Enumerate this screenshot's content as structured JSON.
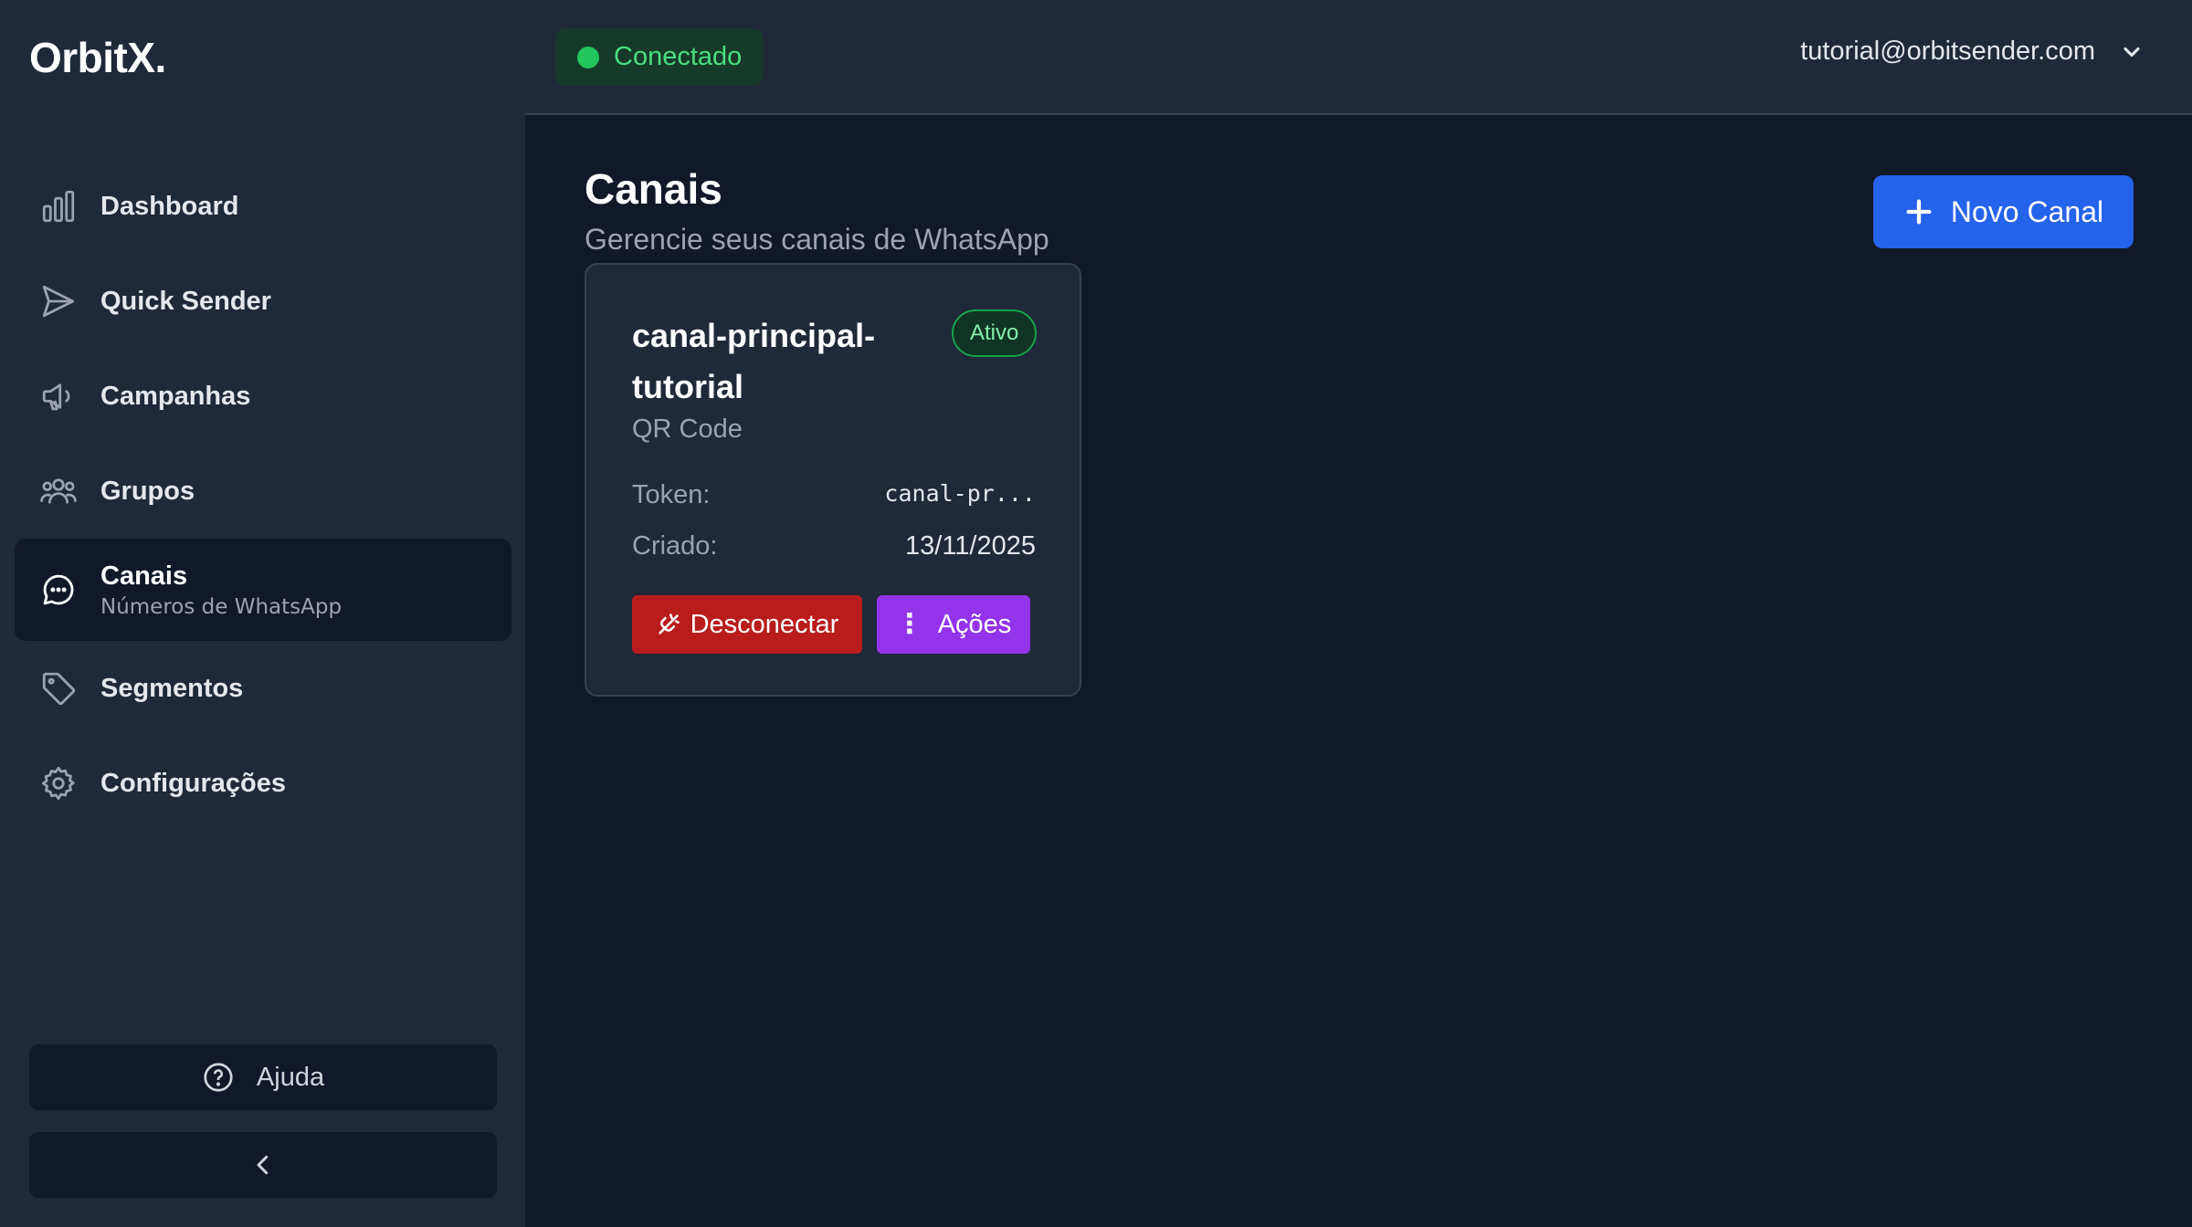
{
  "app": {
    "logo": "OrbitX."
  },
  "sidebar": {
    "items": [
      {
        "label": "Dashboard",
        "icon": "bar-chart-icon"
      },
      {
        "label": "Quick Sender",
        "icon": "send-icon"
      },
      {
        "label": "Campanhas",
        "icon": "megaphone-icon"
      },
      {
        "label": "Grupos",
        "icon": "users-icon"
      },
      {
        "label": "Canais",
        "sublabel": "Números de WhatsApp",
        "icon": "chat-bubble-icon",
        "active": true
      },
      {
        "label": "Segmentos",
        "icon": "tag-icon"
      },
      {
        "label": "Configurações",
        "icon": "gear-icon"
      }
    ],
    "help_label": "Ajuda"
  },
  "header": {
    "status": "Conectado",
    "user_email": "tutorial@orbitsender.com"
  },
  "main": {
    "title": "Canais",
    "subtitle": "Gerencie seus canais de WhatsApp",
    "new_button": "Novo Canal",
    "channel": {
      "name": "canal-principal-tutorial",
      "status": "Ativo",
      "type": "QR Code",
      "token_label": "Token:",
      "token_value": "canal-pr...",
      "created_label": "Criado:",
      "created_value": "13/11/2025",
      "disconnect_label": "Desconectar",
      "actions_label": "Ações"
    }
  },
  "colors": {
    "accent": "#2563eb",
    "success": "#22c55e",
    "danger": "#b91c1c",
    "purple": "#9333ea"
  }
}
